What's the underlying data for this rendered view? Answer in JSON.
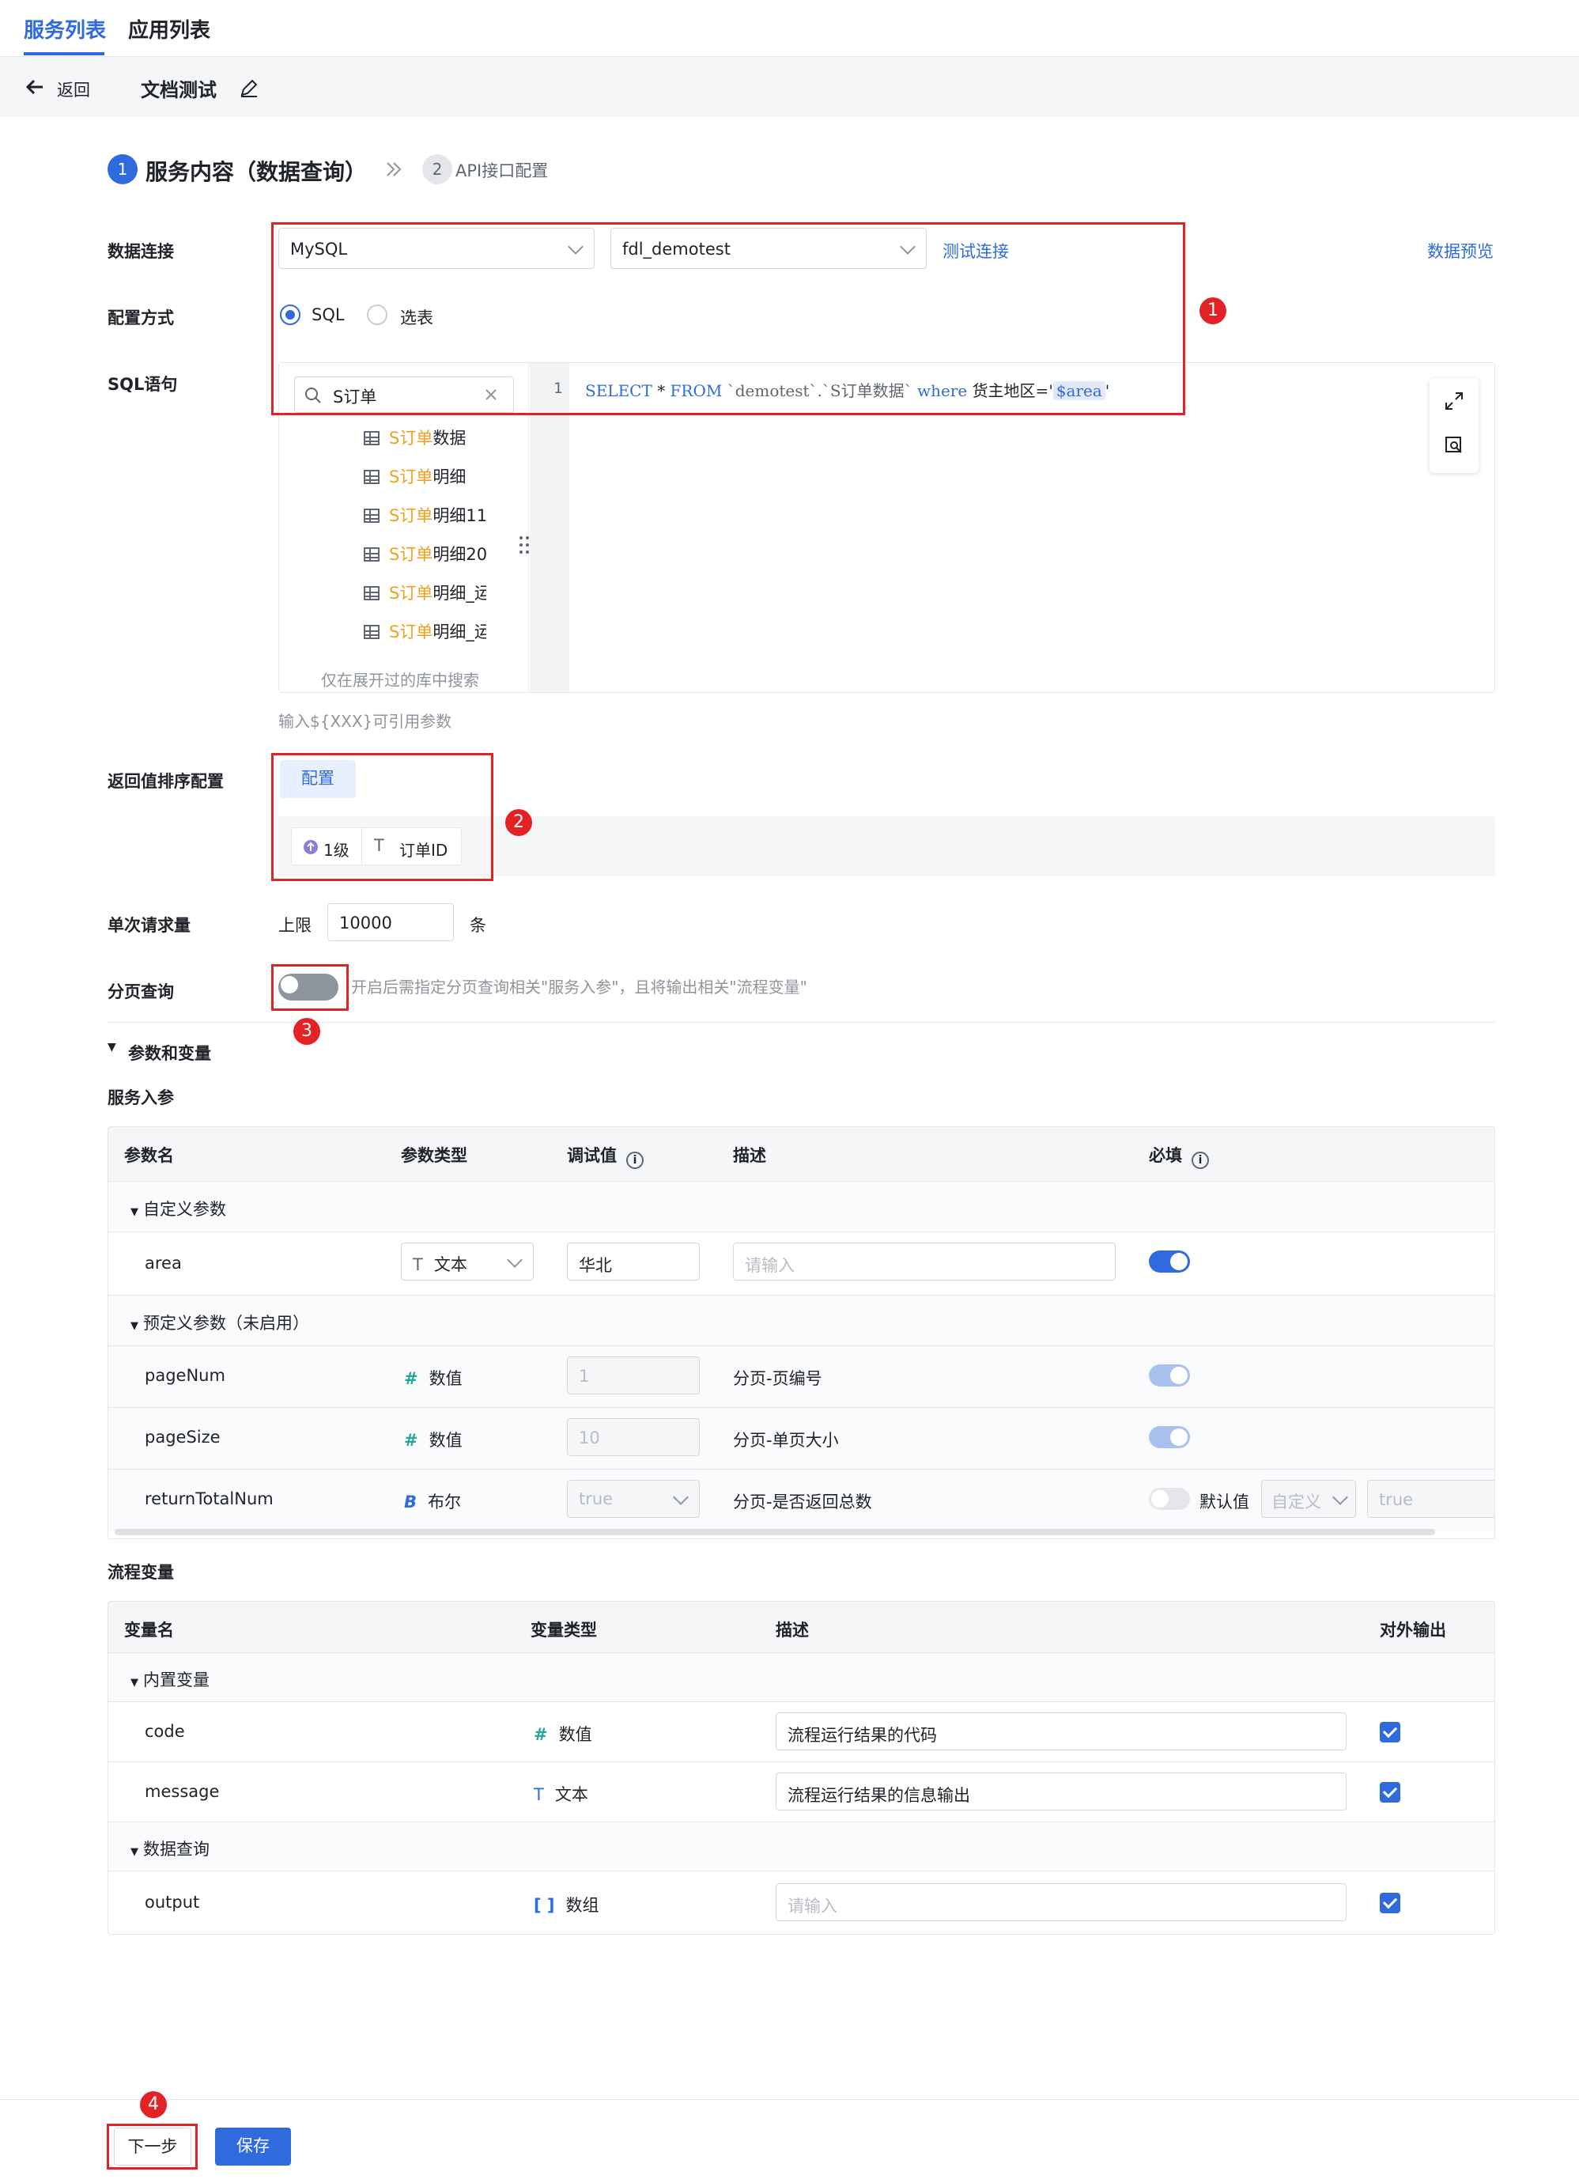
{
  "top_tabs": {
    "service_list": "服务列表",
    "app_list": "应用列表"
  },
  "subbar": {
    "back": "返回",
    "title": "文档测试"
  },
  "steps": {
    "step1_num": "1",
    "step1_label": "服务内容（数据查询）",
    "step2_num": "2",
    "step2_label": "API接口配置"
  },
  "form": {
    "data_conn_label": "数据连接",
    "db_type": "MySQL",
    "db_name": "fdl_demotest",
    "test_conn": "测试连接",
    "preview": "数据预览",
    "config_mode_label": "配置方式",
    "mode_sql": "SQL",
    "mode_table": "选表",
    "sql_label": "SQL语句",
    "search_value": "S订单",
    "tables": [
      {
        "hl": "S订单",
        "rest": "数据"
      },
      {
        "hl": "S订单",
        "rest": "明细"
      },
      {
        "hl": "S订单",
        "rest": "明细11"
      },
      {
        "hl": "S订单",
        "rest": "明细20"
      },
      {
        "hl": "S订单",
        "rest": "明细_运"
      },
      {
        "hl": "S订单",
        "rest": "明细_运"
      }
    ],
    "search_hint": "仅在展开过的库中搜索",
    "line_no": "1",
    "sql_select": "SELECT",
    "sql_star": "*",
    "sql_from": "FROM",
    "sql_ident": "`demotest`.`S订单数据`",
    "sql_where": "where",
    "sql_cond": "货主地区='",
    "sql_param": "$area",
    "sql_end": "'",
    "param_hint": "输入${XXX}可引用参数",
    "sort_label": "返回值排序配置",
    "sort_btn": "配置",
    "sort_level": "1级",
    "sort_field": "订单ID",
    "req_label": "单次请求量",
    "req_limit": "上限",
    "req_value": "10000",
    "req_unit": "条",
    "page_label": "分页查询",
    "page_desc": "开启后需指定分页查询相关\"服务入参\"，且将输出相关\"流程变量\""
  },
  "params": {
    "section": "参数和变量",
    "sub": "服务入参",
    "headers": {
      "name": "参数名",
      "type": "参数类型",
      "debug": "调试值",
      "desc": "描述",
      "required": "必填"
    },
    "group1": "自定义参数",
    "area": {
      "name": "area",
      "type": "文本",
      "debug": "华北",
      "desc_ph": "请输入"
    },
    "group2": "预定义参数（未启用）",
    "pageNum": {
      "name": "pageNum",
      "type": "数值",
      "debug": "1",
      "desc": "分页-页编号"
    },
    "pageSize": {
      "name": "pageSize",
      "type": "数值",
      "debug": "10",
      "desc": "分页-单页大小"
    },
    "returnTotal": {
      "name": "returnTotalNum",
      "type": "布尔",
      "debug": "true",
      "desc": "分页-是否返回总数",
      "default_label": "默认值",
      "default_mode": "自定义",
      "default_val": "true"
    }
  },
  "vars": {
    "sub": "流程变量",
    "headers": {
      "name": "变量名",
      "type": "变量类型",
      "desc": "描述",
      "output": "对外输出"
    },
    "group1": "内置变量",
    "code": {
      "name": "code",
      "type": "数值",
      "desc": "流程运行结果的代码"
    },
    "message": {
      "name": "message",
      "type": "文本",
      "desc": "流程运行结果的信息输出"
    },
    "group2": "数据查询",
    "output": {
      "name": "output",
      "type": "数组",
      "desc_ph": "请输入"
    }
  },
  "footer": {
    "next": "下一步",
    "save": "保存"
  },
  "badges": {
    "b1": "1",
    "b2": "2",
    "b3": "3",
    "b4": "4"
  },
  "colors": {
    "accent": "#2f6bde",
    "annotation": "#e32226",
    "highlight": "#f0a020"
  }
}
